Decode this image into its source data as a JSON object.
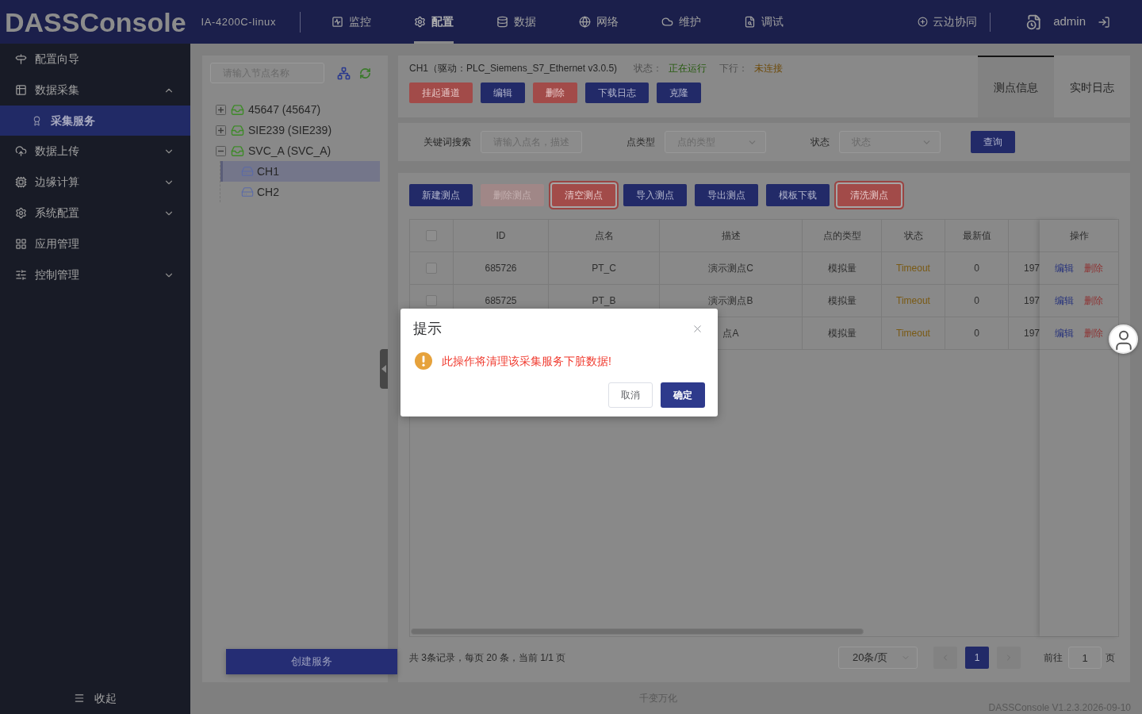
{
  "header": {
    "logo": "DASSConsole",
    "device": "IA-4200C-linux",
    "nav": [
      {
        "label": "监控",
        "selected": false
      },
      {
        "label": "配置",
        "selected": true
      },
      {
        "label": "数据",
        "selected": false
      },
      {
        "label": "网络",
        "selected": false
      },
      {
        "label": "维护",
        "selected": false
      },
      {
        "label": "调试",
        "selected": false
      }
    ],
    "cloud_sync": "云边协同",
    "user": "admin"
  },
  "sidebar": {
    "items": [
      {
        "label": "配置向导",
        "selected": false
      },
      {
        "label": "数据采集",
        "selected": false,
        "expanded": true,
        "children": [
          {
            "label": "采集服务",
            "selected": true
          }
        ]
      },
      {
        "label": "数据上传",
        "selected": false,
        "expanded": false
      },
      {
        "label": "边缘计算",
        "selected": false,
        "expanded": false
      },
      {
        "label": "系统配置",
        "selected": false,
        "expanded": false
      },
      {
        "label": "应用管理",
        "selected": false
      },
      {
        "label": "控制管理",
        "selected": false,
        "expanded": false
      }
    ],
    "collapse": "收起"
  },
  "tree": {
    "search_placeholder": "请输入节点名称",
    "nodes": [
      {
        "label": "45647 (45647)",
        "expanded": false,
        "selected": false
      },
      {
        "label": "SIE239 (SIE239)",
        "expanded": false,
        "selected": false
      },
      {
        "label": "SVC_A (SVC_A)",
        "expanded": true,
        "selected": false,
        "children": [
          {
            "label": "CH1",
            "selected": true
          },
          {
            "label": "CH2",
            "selected": false
          }
        ]
      }
    ],
    "create_button": "创建服务"
  },
  "channel": {
    "title": "CH1（驱动：PLC_Siemens_S7_Ethernet v3.0.5)",
    "status_label": "状态：",
    "status": "正在运行",
    "downlink_label": "下行：",
    "downlink": "未连接",
    "buttons": [
      {
        "label": "挂起通道",
        "kind": "danger"
      },
      {
        "label": "编辑",
        "kind": "primary"
      },
      {
        "label": "删除",
        "kind": "danger"
      },
      {
        "label": "下载日志",
        "kind": "primary"
      },
      {
        "label": "克隆",
        "kind": "primary"
      }
    ],
    "tabs": [
      {
        "label": "测点信息",
        "selected": true
      },
      {
        "label": "实时日志",
        "selected": false
      }
    ]
  },
  "filters": {
    "fields": [
      {
        "label": "关键词搜索",
        "kind": "input",
        "placeholder": "请输入点名，描述"
      },
      {
        "label": "点类型",
        "kind": "select",
        "placeholder": "点的类型"
      },
      {
        "label": "状态",
        "kind": "select",
        "placeholder": "状态"
      }
    ],
    "search_button": "查询"
  },
  "table": {
    "toolbar": [
      {
        "label": "新建测点",
        "kind": "primary",
        "disabled": false,
        "focused": false
      },
      {
        "label": "删除测点",
        "kind": "danger",
        "disabled": true,
        "focused": false
      },
      {
        "label": "清空测点",
        "kind": "danger",
        "disabled": false,
        "focused": true
      },
      {
        "label": "导入测点",
        "kind": "primary",
        "disabled": false,
        "focused": false
      },
      {
        "label": "导出测点",
        "kind": "primary",
        "disabled": false,
        "focused": false
      },
      {
        "label": "模板下载",
        "kind": "primary",
        "disabled": false,
        "focused": false
      },
      {
        "label": "清洗测点",
        "kind": "danger",
        "disabled": false,
        "focused": true
      }
    ],
    "select_all": {
      "checked": false
    },
    "columns": [
      "ID",
      "点名",
      "描述",
      "点的类型",
      "状态",
      "最新值",
      "操作"
    ],
    "rows": [
      {
        "checked": false,
        "id": "685726",
        "name": "PT_C",
        "description": "演示测点C",
        "type": "模拟量",
        "status": "Timeout",
        "latest": "0",
        "column_8": "197",
        "actions": [
          "编辑",
          "删除"
        ]
      },
      {
        "checked": false,
        "id": "685725",
        "name": "PT_B",
        "description": "演示测点B",
        "type": "模拟量",
        "status": "Timeout",
        "latest": "0",
        "column_8": "197",
        "actions": [
          "编辑",
          "删除"
        ]
      },
      {
        "description": "点A",
        "type": "模拟量",
        "status": "Timeout",
        "latest": "0",
        "column_8": "197",
        "actions": [
          "编辑",
          "删除"
        ]
      }
    ]
  },
  "pagination": {
    "summary": "共 3条记录，每页 20 条，当前 1/1 页",
    "page_size": "20条/页",
    "pages": [
      {
        "label": "1",
        "selected": true
      }
    ],
    "goto_label": "前往",
    "goto_value": "1",
    "goto_suffix": "页"
  },
  "dialog": {
    "title": "提示",
    "message": "此操作将清理该采集服务下脏数据!",
    "buttons": [
      {
        "label": "取消",
        "kind": "default"
      },
      {
        "label": "确定",
        "kind": "primary"
      }
    ]
  },
  "footer": {
    "slogan": "千变万化",
    "version": "DASSConsole V1.2.3.2026-09-10"
  }
}
